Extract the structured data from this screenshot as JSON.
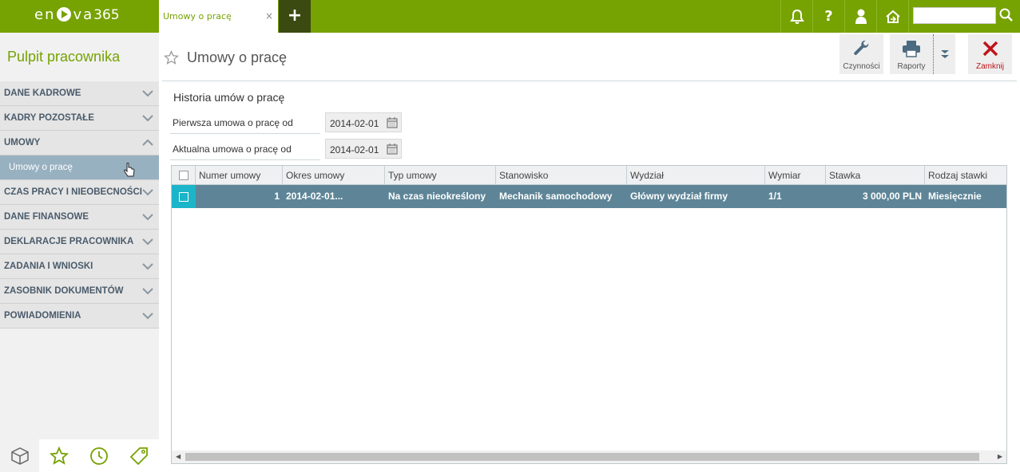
{
  "app": {
    "logo_text": "en",
    "logo_text2": "va",
    "logo_num": "365"
  },
  "tabs": [
    {
      "label": "Umowy o pracę",
      "close": "×"
    }
  ],
  "add_tab": "+",
  "topbar_icons": [
    "bell-icon",
    "help-icon",
    "user-icon",
    "home-icon"
  ],
  "help_glyph": "?",
  "search": {
    "value": "",
    "placeholder": ""
  },
  "sidebar": {
    "title": "Pulpit pracownika",
    "items": [
      {
        "label": "DANE KADROWE",
        "expanded": false
      },
      {
        "label": "KADRY POZOSTAŁE",
        "expanded": false
      },
      {
        "label": "UMOWY",
        "expanded": true
      },
      {
        "label": "Umowy o pracę",
        "sub": true
      },
      {
        "label": "CZAS PRACY I NIEOBECNOŚCI",
        "expanded": false
      },
      {
        "label": "DANE FINANSOWE",
        "expanded": false
      },
      {
        "label": "DEKLARACJE PRACOWNIKA",
        "expanded": false
      },
      {
        "label": "ZADANIA I WNIOSKI",
        "expanded": false
      },
      {
        "label": "ZASOBNIK DOKUMENTÓW",
        "expanded": false
      },
      {
        "label": "POWIADOMIENIA",
        "expanded": false
      }
    ],
    "footer_icons": [
      "box-icon",
      "star-icon",
      "clock-icon",
      "tag-icon"
    ]
  },
  "page": {
    "title": "Umowy o pracę",
    "toolbar": {
      "actions_label": "Czynności",
      "reports_label": "Raporty",
      "close_label": "Zamknij"
    },
    "section_title": "Historia umów o pracę",
    "fields": [
      {
        "label": "Pierwsza umowa o pracę od",
        "value": "2014-02-01"
      },
      {
        "label": "Aktualna umowa o pracę od",
        "value": "2014-02-01"
      }
    ]
  },
  "grid": {
    "columns": [
      "Numer umowy",
      "Okres umowy",
      "Typ umowy",
      "Stanowisko",
      "Wydział",
      "Wymiar",
      "Stawka",
      "Rodzaj stawki"
    ],
    "rows": [
      {
        "numer": "1",
        "okres": "2014-02-01...",
        "typ": "Na czas nieokreślony",
        "stanowisko": "Mechanik samochodowy",
        "wydzial": "Główny wydział firmy",
        "wymiar": "1/1",
        "stawka": "3 000,00 PLN",
        "rodzaj": "Miesięcznie"
      }
    ]
  },
  "colors": {
    "brand": "#76a202",
    "selected_row": "#5e8597",
    "checkbox_cell": "#1bb5c9",
    "close_red": "#c0141b"
  }
}
